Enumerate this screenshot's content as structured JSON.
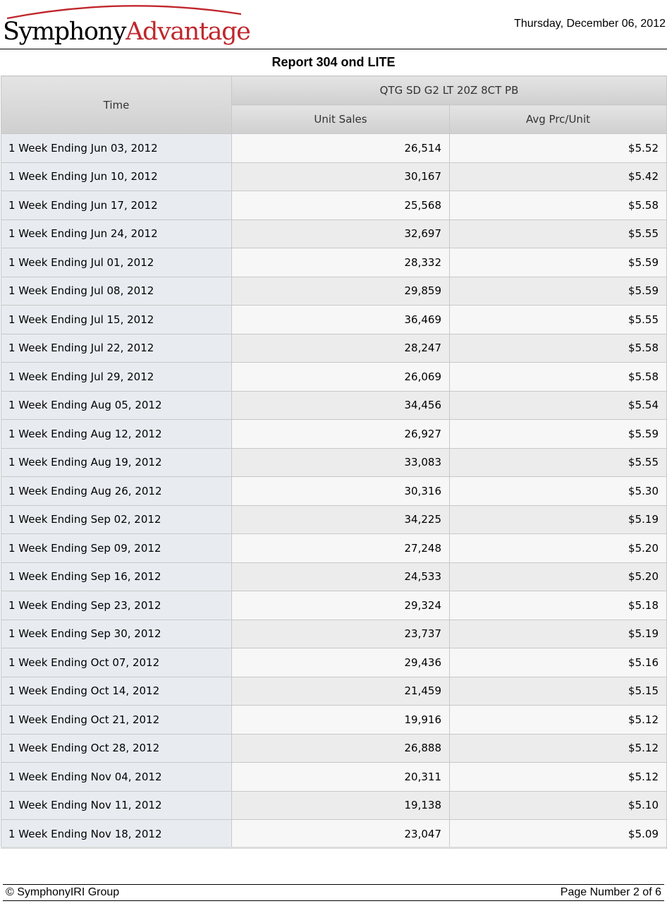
{
  "header": {
    "logo_part1": "Symphony",
    "logo_part2": "Advantage",
    "date": "Thursday, December 06, 2012"
  },
  "report": {
    "title": "Report 304 ond LITE",
    "time_label": "Time",
    "product": "QTG SD G2 LT 20Z 8CT PB",
    "columns": [
      "Unit Sales",
      "Avg Prc/Unit"
    ],
    "rows": [
      [
        "1 Week Ending Jun 03, 2012",
        "26,514",
        "$5.52"
      ],
      [
        "1 Week Ending Jun 10, 2012",
        "30,167",
        "$5.42"
      ],
      [
        "1 Week Ending Jun 17, 2012",
        "25,568",
        "$5.58"
      ],
      [
        "1 Week Ending Jun 24, 2012",
        "32,697",
        "$5.55"
      ],
      [
        "1 Week Ending Jul 01, 2012",
        "28,332",
        "$5.59"
      ],
      [
        "1 Week Ending Jul 08, 2012",
        "29,859",
        "$5.59"
      ],
      [
        "1 Week Ending Jul 15, 2012",
        "36,469",
        "$5.55"
      ],
      [
        "1 Week Ending Jul 22, 2012",
        "28,247",
        "$5.58"
      ],
      [
        "1 Week Ending Jul 29, 2012",
        "26,069",
        "$5.58"
      ],
      [
        "1 Week Ending Aug 05, 2012",
        "34,456",
        "$5.54"
      ],
      [
        "1 Week Ending Aug 12, 2012",
        "26,927",
        "$5.59"
      ],
      [
        "1 Week Ending Aug 19, 2012",
        "33,083",
        "$5.55"
      ],
      [
        "1 Week Ending Aug 26, 2012",
        "30,316",
        "$5.30"
      ],
      [
        "1 Week Ending Sep 02, 2012",
        "34,225",
        "$5.19"
      ],
      [
        "1 Week Ending Sep 09, 2012",
        "27,248",
        "$5.20"
      ],
      [
        "1 Week Ending Sep 16, 2012",
        "24,533",
        "$5.20"
      ],
      [
        "1 Week Ending Sep 23, 2012",
        "29,324",
        "$5.18"
      ],
      [
        "1 Week Ending Sep 30, 2012",
        "23,737",
        "$5.19"
      ],
      [
        "1 Week Ending Oct 07, 2012",
        "29,436",
        "$5.16"
      ],
      [
        "1 Week Ending Oct 14, 2012",
        "21,459",
        "$5.15"
      ],
      [
        "1 Week Ending Oct 21, 2012",
        "19,916",
        "$5.12"
      ],
      [
        "1 Week Ending Oct 28, 2012",
        "26,888",
        "$5.12"
      ],
      [
        "1 Week Ending Nov 04, 2012",
        "20,311",
        "$5.12"
      ],
      [
        "1 Week Ending Nov 11, 2012",
        "19,138",
        "$5.10"
      ],
      [
        "1 Week Ending Nov 18, 2012",
        "23,047",
        "$5.09"
      ]
    ]
  },
  "footer": {
    "copyright": "© SymphonyIRI Group",
    "page": "Page Number 2 of 6"
  },
  "colors": {
    "logo_accent": "#c0272d",
    "time_cell_bg": "#e8ecf1",
    "header_bg": "#d6d6d6"
  }
}
